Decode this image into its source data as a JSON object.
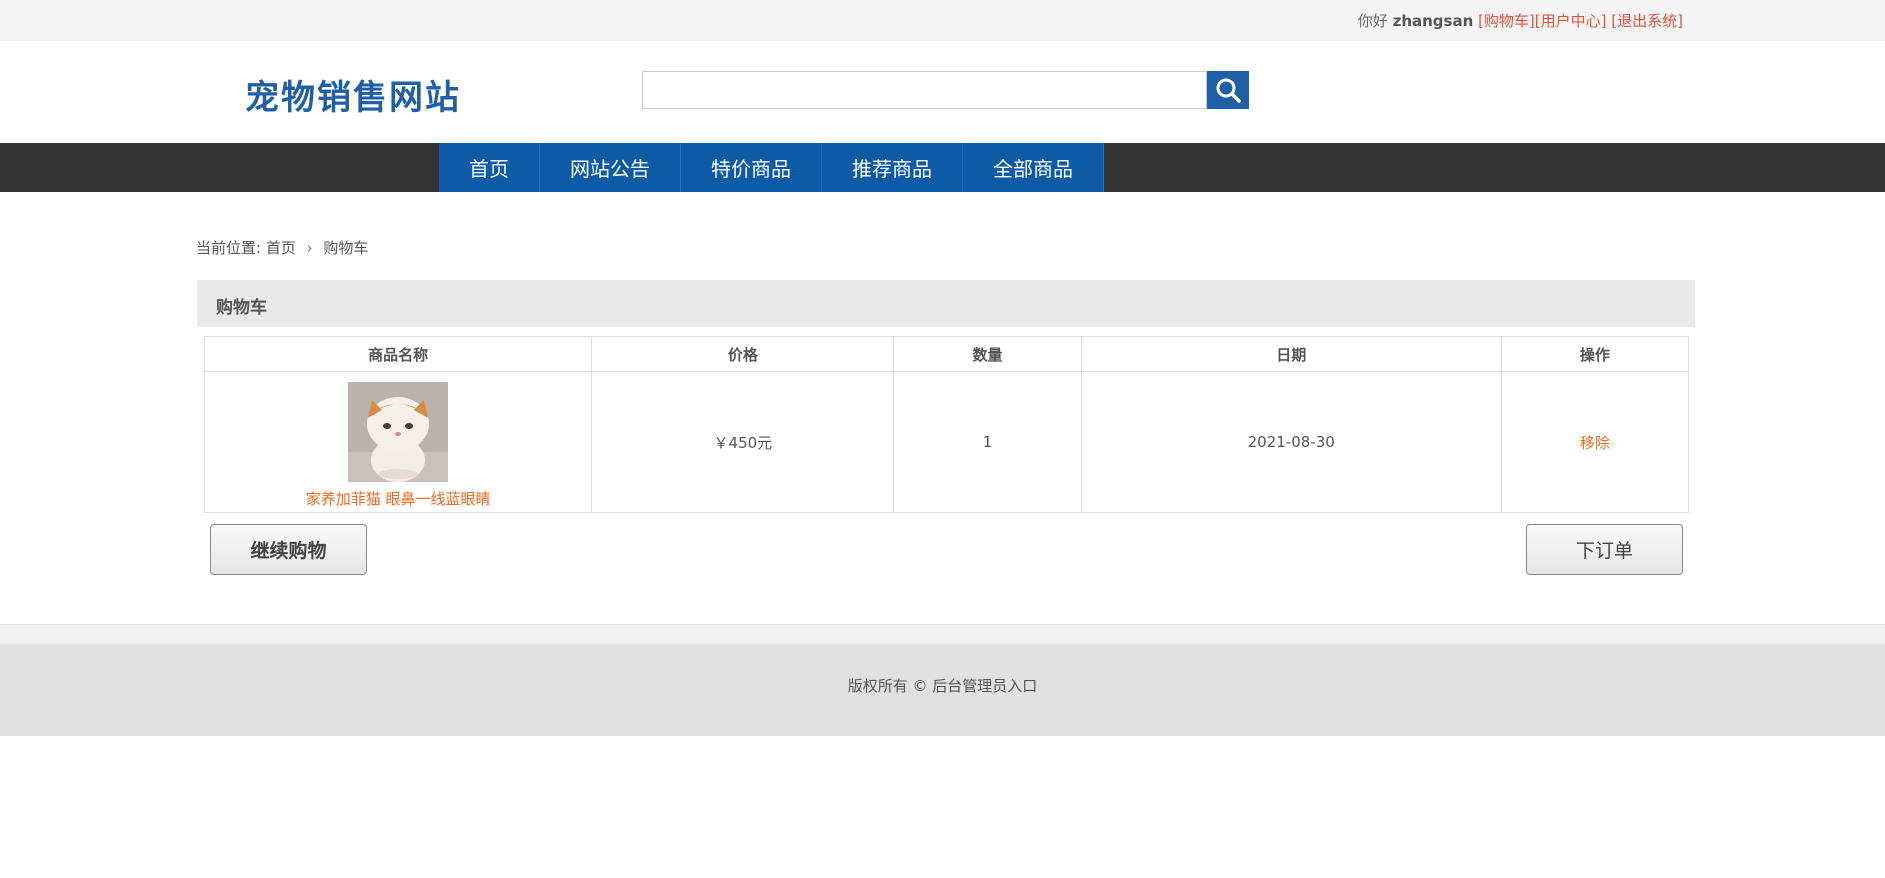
{
  "topbar": {
    "greeting": "你好",
    "username": "zhangsan",
    "cart_link": "[购物车]",
    "user_center_link": "[用户中心]",
    "logout_link": "[退出系统]"
  },
  "header": {
    "logo": "宠物销售网站",
    "search": {
      "value": "",
      "placeholder": ""
    },
    "search_icon": "search-icon"
  },
  "nav": {
    "items": [
      {
        "label": "首页"
      },
      {
        "label": "网站公告"
      },
      {
        "label": "特价商品"
      },
      {
        "label": "推荐商品"
      },
      {
        "label": "全部商品"
      }
    ]
  },
  "breadcrumb": {
    "prefix": "当前位置:",
    "home": "首页",
    "current": "购物车"
  },
  "cart": {
    "title": "购物车",
    "columns": [
      "商品名称",
      "价格",
      "数量",
      "日期",
      "操作"
    ],
    "rows": [
      {
        "name": "家养加菲猫 眼鼻一线蓝眼睛",
        "price": "￥450元",
        "quantity": "1",
        "date": "2021-08-30",
        "action": "移除"
      }
    ],
    "continue_button": "继续购物",
    "order_button": "下订单"
  },
  "footer": {
    "copyright": "版权所有 ©",
    "admin_link": "后台管理员入口"
  },
  "colors": {
    "brand_blue": "#1f5fa6",
    "nav_blue": "#0d5aa7",
    "link_red": "#e8503a",
    "accent_orange": "#f06a1d"
  }
}
